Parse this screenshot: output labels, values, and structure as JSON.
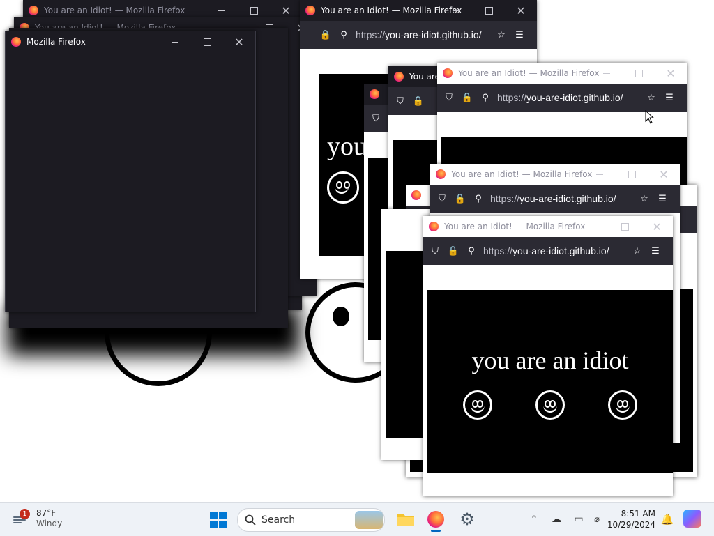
{
  "windows": [
    {
      "title": "You are an Idiot! — Mozilla Firefox"
    },
    {
      "title": "Mozilla Firefox"
    }
  ],
  "firefox": {
    "url_proto": "https://",
    "url_host": "you-are-idiot.github.io/"
  },
  "page": {
    "headline": "you are an idiot",
    "partial_headline": "you"
  },
  "taskbar": {
    "weather_temp": "87°F",
    "weather_desc": "Windy",
    "weather_badge": "1",
    "search_placeholder": "Search",
    "time": "8:51 AM",
    "date": "10/29/2024"
  }
}
